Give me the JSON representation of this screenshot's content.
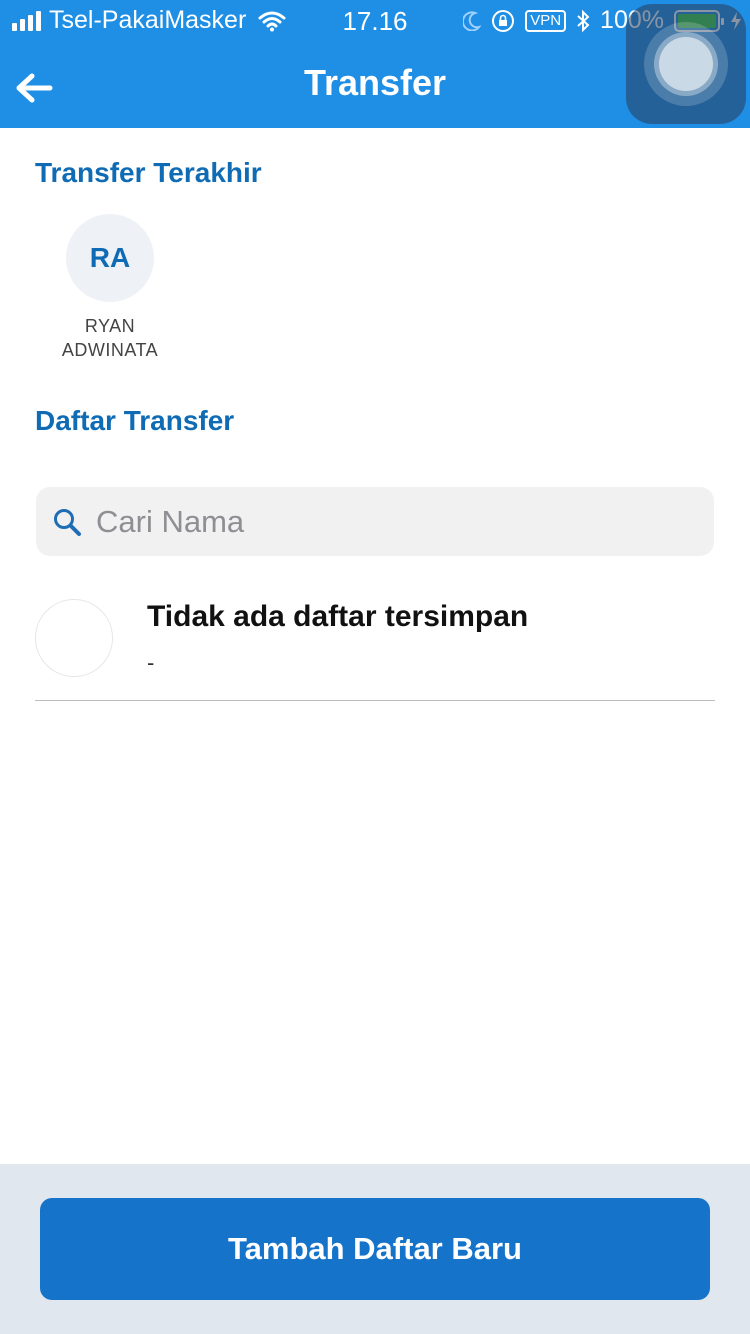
{
  "status_bar": {
    "carrier": "Tsel-PakaiMasker",
    "time": "17.16",
    "vpn": "VPN",
    "battery": "100%"
  },
  "header": {
    "title": "Transfer"
  },
  "recent": {
    "title": "Transfer Terakhir",
    "items": [
      {
        "initials": "RA",
        "name_line1": "RYAN",
        "name_line2": "ADWINATA"
      }
    ]
  },
  "list": {
    "title": "Daftar Transfer",
    "search_placeholder": "Cari Nama",
    "items": [
      {
        "title": "Tidak ada daftar tersimpan",
        "subtitle": "-"
      }
    ]
  },
  "footer": {
    "button_label": "Tambah Daftar Baru"
  },
  "colors": {
    "header": "#1f8fe5",
    "accent": "#0f6bb4",
    "button": "#1573c9",
    "footer_bg": "#e1e7ef"
  }
}
